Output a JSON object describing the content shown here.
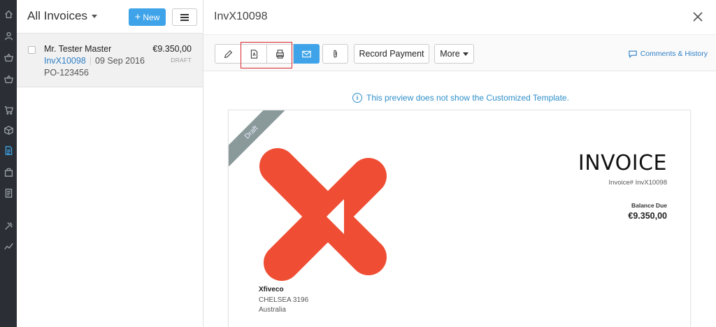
{
  "list": {
    "title": "All Invoices",
    "new_label": "New",
    "invoice": {
      "customer": "Mr. Tester Master",
      "amount": "€9.350,00",
      "number": "InvX10098",
      "date": "09 Sep 2016",
      "status": "DRAFT",
      "reference": "PO-123456"
    }
  },
  "detail": {
    "title": "InvX10098",
    "toolbar": {
      "record_payment": "Record Payment",
      "more": "More",
      "comments": "Comments & History"
    },
    "notice": "This preview does not show the Customized Template.",
    "document": {
      "ribbon": "Draft",
      "heading": "INVOICE",
      "invoice_ref": "Invoice# InvX10098",
      "balance_label": "Balance Due",
      "balance_value": "€9.350,00",
      "company_name": "Xfiveco",
      "address": [
        "CHELSEA  3196",
        "Australia"
      ]
    }
  },
  "colors": {
    "accent": "#3ea3e8",
    "logo": "#ef4e35",
    "ribbon": "#8a9a9b",
    "highlight": "#d9262b"
  },
  "icons": {
    "rail": [
      "home-icon",
      "user-icon",
      "basket-icon",
      "basket-icon",
      "cart-icon",
      "box-icon",
      "document-icon",
      "bag-icon",
      "notebook-icon",
      "tools-icon",
      "chart-icon"
    ],
    "toolbar": [
      "pencil-icon",
      "pdf-icon",
      "printer-icon",
      "mail-icon",
      "paperclip-icon"
    ]
  }
}
